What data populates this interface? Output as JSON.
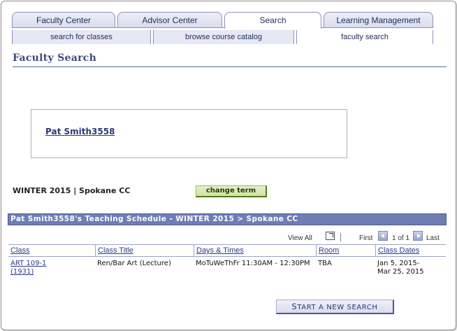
{
  "tabs": [
    {
      "label": "Faculty Center"
    },
    {
      "label": "Advisor Center"
    },
    {
      "label": "Search"
    },
    {
      "label": "Learning Management"
    }
  ],
  "subtabs": [
    {
      "label": "search for classes"
    },
    {
      "label": "browse course catalog"
    },
    {
      "label": "faculty search"
    }
  ],
  "page": {
    "title": "Faculty Search"
  },
  "faculty": {
    "name": "Pat Smith3558"
  },
  "term": {
    "text": "WINTER 2015 | Spokane CC",
    "change_label": "change term"
  },
  "schedule": {
    "header": "Pat Smith3558's Teaching Schedule - WINTER 2015 > Spokane CC",
    "view_all": "View All",
    "first": "First",
    "range": "1 of 1",
    "last": "Last",
    "columns": [
      "Class",
      "Class Title",
      "Days & Times",
      "Room",
      "Class Dates"
    ],
    "rows": [
      {
        "class_line1": "ART 109-1",
        "class_line2": "(1931)",
        "title": "Ren/Bar Art (Lecture)",
        "days_times": "MoTuWeThFr 11:30AM - 12:30PM",
        "room": "TBA",
        "dates_line1": "Jan 5, 2015-",
        "dates_line2": "Mar 25, 2015"
      }
    ]
  },
  "actions": {
    "new_search_first": "S",
    "new_search_rest": "TART A NEW SEARCH"
  },
  "colors": {
    "header_bg": "#6e7db6",
    "link": "#2a3a8a",
    "title": "#3b4a78",
    "change_term_bg": "#cfe4a0"
  }
}
